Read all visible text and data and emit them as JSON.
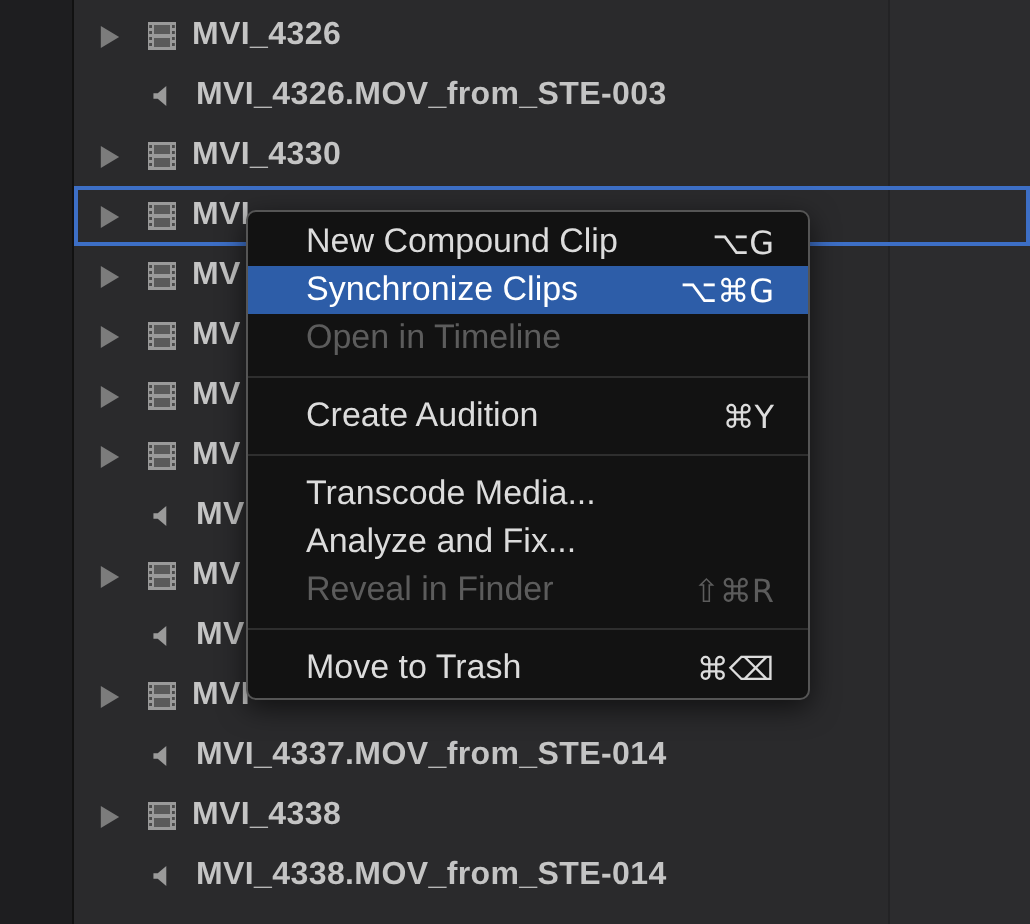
{
  "rows": [
    {
      "kind": "clip",
      "name": "MVI_4326",
      "selected": false
    },
    {
      "kind": "audio",
      "name": "MVI_4326.MOV_from_STE-003",
      "selected": false
    },
    {
      "kind": "clip",
      "name": "MVI_4330",
      "selected": false
    },
    {
      "kind": "clip",
      "name": "MVI",
      "selected": true
    },
    {
      "kind": "clip",
      "name": "MV",
      "selected": false
    },
    {
      "kind": "clip",
      "name": "MV",
      "selected": false
    },
    {
      "kind": "clip",
      "name": "MV",
      "selected": false
    },
    {
      "kind": "clip",
      "name": "MV",
      "selected": false
    },
    {
      "kind": "audio",
      "name": "MV",
      "selected": false
    },
    {
      "kind": "clip",
      "name": "MV",
      "selected": false
    },
    {
      "kind": "audio",
      "name": "MV",
      "selected": false
    },
    {
      "kind": "clip",
      "name": "MVI",
      "selected": false
    },
    {
      "kind": "audio",
      "name": "MVI_4337.MOV_from_STE-014",
      "selected": false
    },
    {
      "kind": "clip",
      "name": "MVI_4338",
      "selected": false
    },
    {
      "kind": "audio",
      "name": "MVI_4338.MOV_from_STE-014",
      "selected": false
    }
  ],
  "context_menu": {
    "items": [
      {
        "kind": "item",
        "label": "New Compound Clip",
        "shortcut": "⌥G",
        "disabled": false,
        "selected": false
      },
      {
        "kind": "item",
        "label": "Synchronize Clips",
        "shortcut": "⌥⌘G",
        "disabled": false,
        "selected": true
      },
      {
        "kind": "item",
        "label": "Open in Timeline",
        "disabled": true,
        "selected": false
      },
      {
        "kind": "separator"
      },
      {
        "kind": "item",
        "label": "Create Audition",
        "shortcut": "⌘Y",
        "disabled": false,
        "selected": false
      },
      {
        "kind": "separator"
      },
      {
        "kind": "item",
        "label": "Transcode Media...",
        "disabled": false,
        "selected": false
      },
      {
        "kind": "item",
        "label": "Analyze and Fix...",
        "disabled": false,
        "selected": false
      },
      {
        "kind": "item",
        "label": "Reveal in Finder",
        "shortcut": "⇧⌘R",
        "disabled": true,
        "selected": false
      },
      {
        "kind": "separator"
      },
      {
        "kind": "item",
        "label": "Move to Trash",
        "shortcut": "⌘⌫",
        "disabled": false,
        "selected": false
      }
    ]
  }
}
